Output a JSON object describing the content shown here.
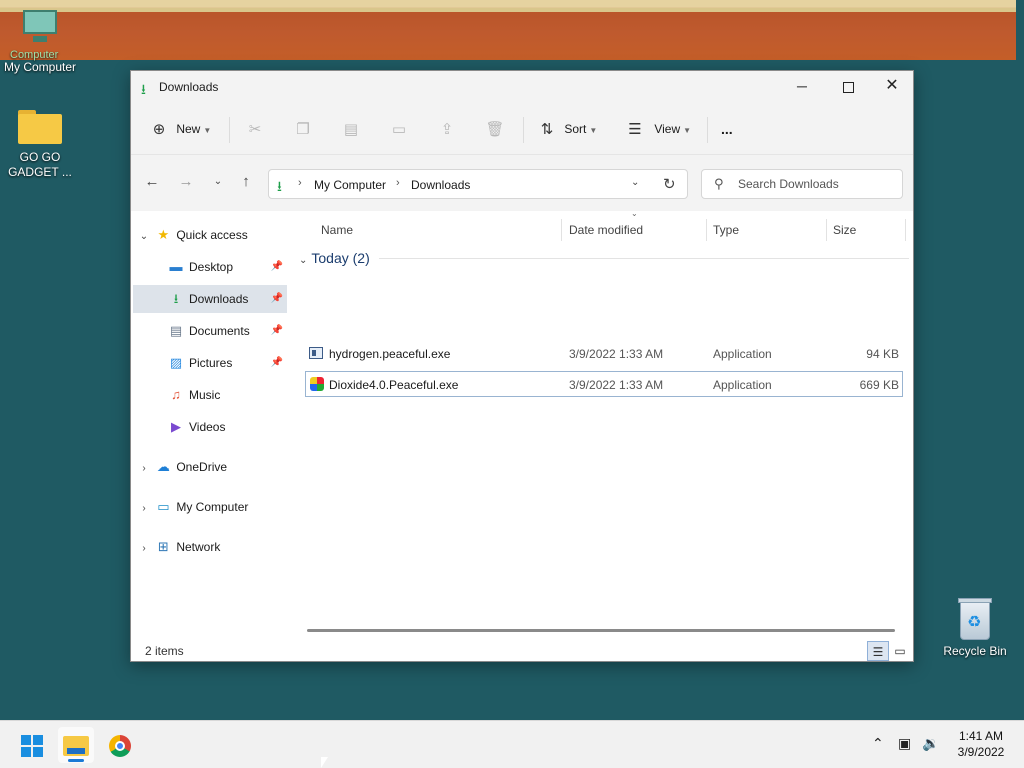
{
  "desktop": {
    "icons": [
      {
        "label": "My Computer",
        "overlay": "Computer"
      },
      {
        "label_line1": "GO GO",
        "label_line2": "GADGET ..."
      },
      {
        "label": "Recycle Bin"
      }
    ]
  },
  "window": {
    "title": "Downloads",
    "icons": {
      "title": "download-arrow",
      "minimize": "minimize",
      "maximize": "maximize",
      "close": "close"
    }
  },
  "ribbon": {
    "new_label": "New",
    "sort_label": "Sort",
    "view_label": "View",
    "more_label": "...",
    "disabled_icons": [
      "cut",
      "copy",
      "paste",
      "rename",
      "share",
      "delete"
    ]
  },
  "address": {
    "crumbs": [
      "My Computer",
      "Downloads"
    ],
    "search_placeholder": "Search Downloads"
  },
  "sidebar": {
    "quick_access": "Quick access",
    "items": [
      {
        "label": "Desktop",
        "pinned": true
      },
      {
        "label": "Downloads",
        "pinned": true,
        "selected": true
      },
      {
        "label": "Documents",
        "pinned": true
      },
      {
        "label": "Pictures",
        "pinned": true
      },
      {
        "label": "Music",
        "pinned": false
      },
      {
        "label": "Videos",
        "pinned": false
      }
    ],
    "roots": [
      "OneDrive",
      "My Computer",
      "Network"
    ]
  },
  "columns": [
    "Name",
    "Date modified",
    "Type",
    "Size"
  ],
  "group": {
    "label": "Today (2)"
  },
  "files": [
    {
      "name": "hydrogen.peaceful.exe",
      "date": "3/9/2022 1:33 AM",
      "type": "Application",
      "size": "94 KB"
    },
    {
      "name": "Dioxide4.0.Peaceful.exe",
      "date": "3/9/2022 1:33 AM",
      "type": "Application",
      "size": "669 KB"
    }
  ],
  "status": {
    "count": "2 items"
  },
  "taskbar": {
    "time": "1:41 AM",
    "date": "3/9/2022"
  },
  "colors": {
    "desktop_bg": "#1f5a63",
    "accent": "#1a7ad6",
    "download_green": "#1e9e4a",
    "selected_bg": "#dde3ea"
  }
}
